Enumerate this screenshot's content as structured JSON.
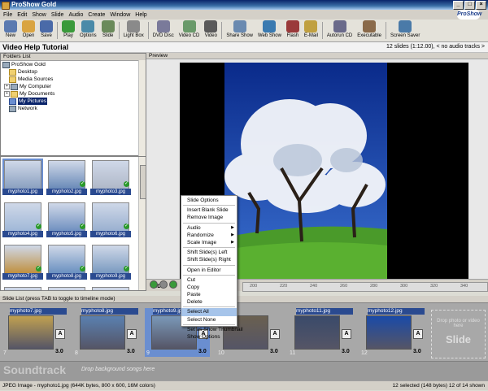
{
  "window": {
    "title": "ProShow Gold",
    "logo_text": "ProShow"
  },
  "menu": [
    "File",
    "Edit",
    "Show",
    "Slide",
    "Audio",
    "Create",
    "Window",
    "Help"
  ],
  "toolbar": [
    {
      "label": "New",
      "icon": "new-icon",
      "color": "#5a7ab0"
    },
    {
      "label": "Open",
      "icon": "open-icon",
      "color": "#d9a441"
    },
    {
      "label": "Save",
      "icon": "save-icon",
      "color": "#4a6aa8"
    },
    {
      "label": "Play",
      "icon": "play-icon",
      "color": "#3a9a3a"
    },
    {
      "label": "Options",
      "icon": "options-icon",
      "color": "#4a8aa8"
    },
    {
      "label": "Slide",
      "icon": "slide-icon",
      "color": "#6a8a5a"
    },
    {
      "label": "Light Box",
      "icon": "lightbox-icon",
      "color": "#8a8a8a"
    },
    {
      "label": "DVD Disc",
      "icon": "dvd-icon",
      "color": "#7a7a9a"
    },
    {
      "label": "Video CD",
      "icon": "videocd-icon",
      "color": "#6a9a6a"
    },
    {
      "label": "Video",
      "icon": "video-icon",
      "color": "#5a5a5a"
    },
    {
      "label": "Share Show",
      "icon": "share-icon",
      "color": "#6a8ab0"
    },
    {
      "label": "Web Show",
      "icon": "web-icon",
      "color": "#3a7ab0"
    },
    {
      "label": "Flash",
      "icon": "flash-icon",
      "color": "#9a3a3a"
    },
    {
      "label": "E-Mail",
      "icon": "email-icon",
      "color": "#c0a040"
    },
    {
      "label": "Autorun CD",
      "icon": "autorun-icon",
      "color": "#6a6a8a"
    },
    {
      "label": "Executable",
      "icon": "executable-icon",
      "color": "#8a6a4a"
    },
    {
      "label": "Screen Saver",
      "icon": "screensaver-icon",
      "color": "#4a7aa8"
    }
  ],
  "project": {
    "title": "Video Help Tutorial",
    "info": "12 slides (1:12.00), < no audio tracks >"
  },
  "folders": {
    "header": "Folders List",
    "items": [
      "ProShow Gold",
      "Desktop",
      "Media Sources",
      "My Computer",
      "My Documents",
      "My Pictures",
      "Network"
    ]
  },
  "files": [
    {
      "name": "myphoto1.jpg",
      "color": "#8aa0c0",
      "selected": true,
      "check": false
    },
    {
      "name": "myphoto2.jpg",
      "color": "#6a8ab8",
      "selected": false,
      "check": true
    },
    {
      "name": "myphoto3.jpg",
      "color": "#b0b8c8",
      "selected": false,
      "check": true
    },
    {
      "name": "myphoto4.jpg",
      "color": "#a0b8d8",
      "selected": false,
      "check": true
    },
    {
      "name": "myphoto5.jpg",
      "color": "#7090c0",
      "selected": false,
      "check": true
    },
    {
      "name": "myphoto6.jpg",
      "color": "#9ab0d0",
      "selected": false,
      "check": true
    },
    {
      "name": "myphoto7.jpg",
      "color": "#c09040",
      "selected": false,
      "check": true
    },
    {
      "name": "myphoto8.jpg",
      "color": "#6a90c0",
      "selected": false,
      "check": true
    },
    {
      "name": "myphoto9.jpg",
      "color": "#7a9ac0",
      "selected": false,
      "check": true
    },
    {
      "name": "",
      "color": "#8a9ab0",
      "selected": false,
      "check": false
    },
    {
      "name": "",
      "color": "#c0c8d8",
      "selected": false,
      "check": false
    },
    {
      "name": "",
      "color": "#a0a8b8",
      "selected": false,
      "check": false
    }
  ],
  "preview": {
    "header": "Preview",
    "vcd_label": "VCD",
    "ruler": [
      "200",
      "220",
      "240",
      "260",
      "280",
      "300",
      "320",
      "340"
    ]
  },
  "context_menu": [
    {
      "label": "Slide Options"
    },
    {
      "sep": true
    },
    {
      "label": "Insert Blank Slide"
    },
    {
      "label": "Remove Image"
    },
    {
      "sep": true
    },
    {
      "label": "Audio",
      "arrow": true
    },
    {
      "label": "Randomize",
      "arrow": true
    },
    {
      "label": "Scale Image",
      "arrow": true
    },
    {
      "sep": true
    },
    {
      "label": "Shift Slide(s) Left"
    },
    {
      "label": "Shift Slide(s) Right"
    },
    {
      "sep": true
    },
    {
      "label": "Open in Editor"
    },
    {
      "sep": true
    },
    {
      "label": "Cut"
    },
    {
      "label": "Copy"
    },
    {
      "label": "Paste"
    },
    {
      "label": "Delete"
    },
    {
      "sep": true
    },
    {
      "label": "Select All",
      "highlight": true
    },
    {
      "label": "Select None"
    },
    {
      "sep": true
    },
    {
      "label": "Set as Show Thumbnail"
    },
    {
      "label": "Show Options"
    }
  ],
  "slide_list": {
    "header": "Slide List (press TAB to toggle to timeline mode)",
    "slides": [
      {
        "name": "myphoto7.jpg",
        "num": "7",
        "dur": "3.0",
        "color": "#c0a050"
      },
      {
        "name": "myphoto8.jpg",
        "num": "8",
        "dur": "3.0",
        "color": "#5a80b0"
      },
      {
        "name": "myphoto9.jpg",
        "num": "9",
        "dur": "3.0",
        "color": "#7a98b8",
        "selected": true
      },
      {
        "name": "",
        "num": "10",
        "dur": "3.0",
        "color": "#6a6050"
      },
      {
        "name": "myphoto11.jpg",
        "num": "11",
        "dur": "3.0",
        "color": "#3a4a6a"
      },
      {
        "name": "myphoto12.jpg",
        "num": "12",
        "dur": "3.0",
        "color": "#1a4aa8"
      }
    ],
    "empty_slot": {
      "hint": "Drop photo or video here",
      "label": "Slide"
    }
  },
  "soundtrack": {
    "label": "Soundtrack",
    "hint": "Drop background songs here"
  },
  "status": {
    "left": "JPEG Image - myphoto1.jpg (644K bytes, 800 x 600, 16M colors)",
    "right": "12 selected (148 bytes) 12 of 14 shown"
  }
}
